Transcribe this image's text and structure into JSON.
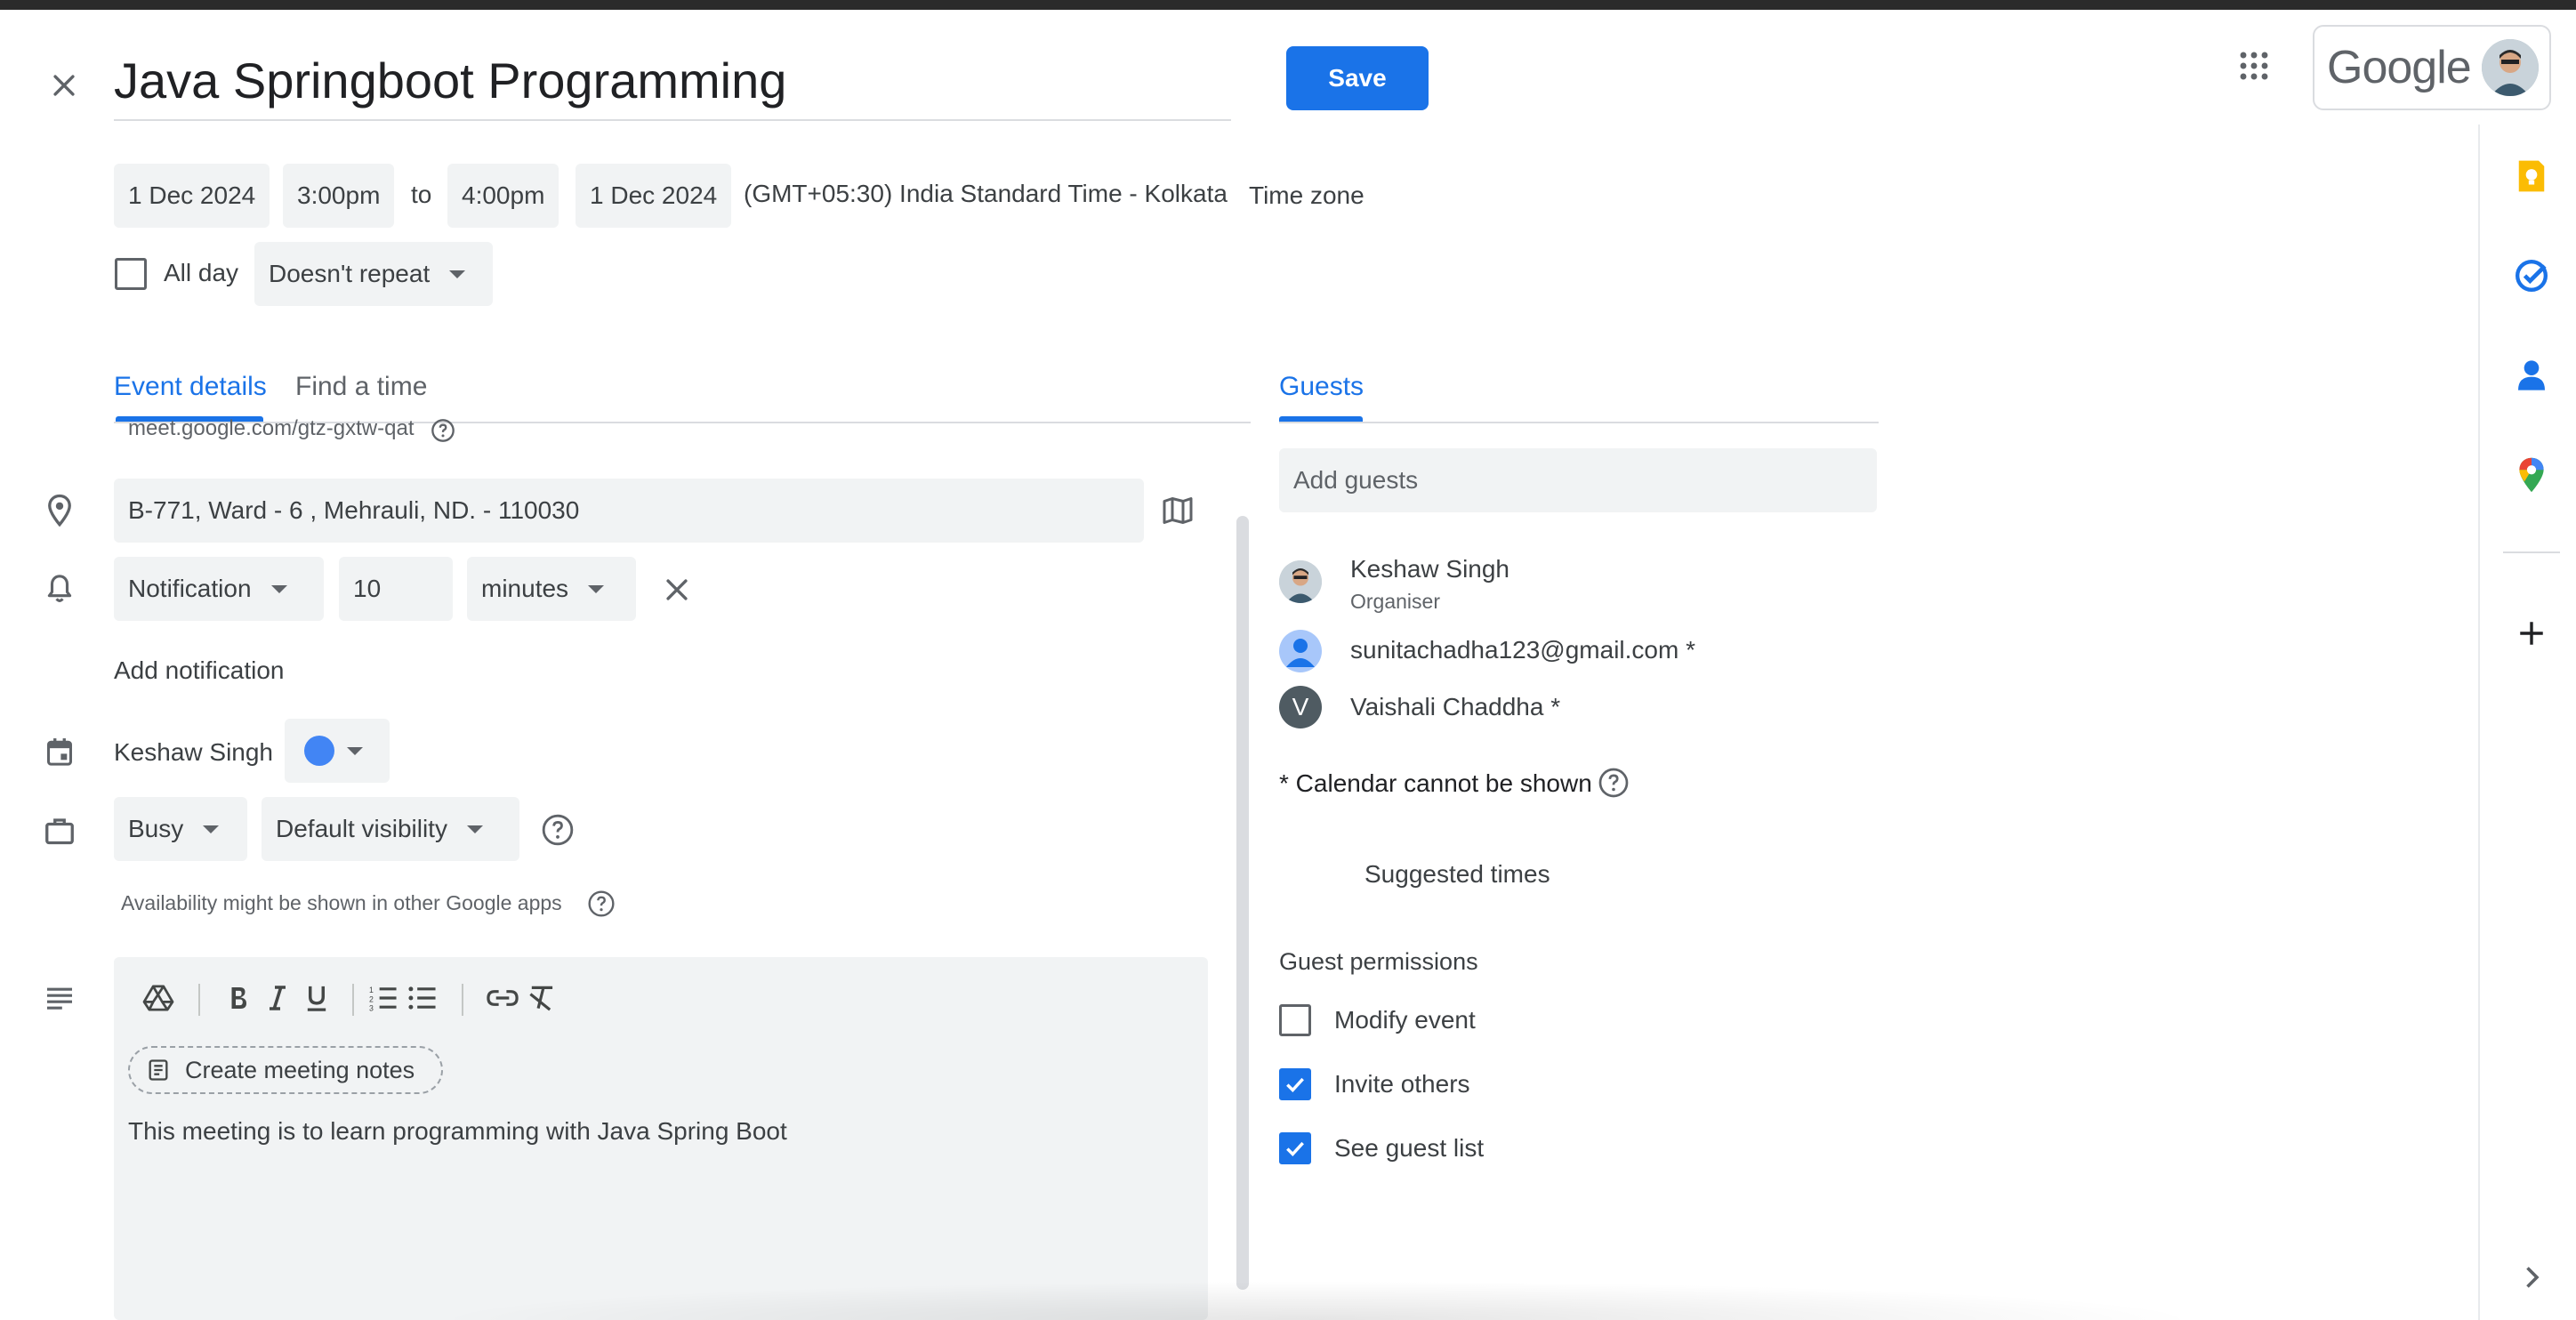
{
  "header": {
    "close_icon": "close-icon",
    "title": "Java Springboot Programming",
    "save_label": "Save",
    "apps_icon": "apps-grid-icon",
    "account_brand": "Google"
  },
  "datetime": {
    "start_date": "1 Dec 2024",
    "start_time": "3:00pm",
    "to_label": "to",
    "end_time": "4:00pm",
    "end_date": "1 Dec 2024",
    "timezone_value": "(GMT+05:30) India Standard Time - Kolkata",
    "timezone_button": "Time zone",
    "all_day_label": "All day",
    "all_day_checked": false,
    "repeat_value": "Doesn't repeat"
  },
  "tabs": {
    "event_details": "Event details",
    "find_a_time": "Find a time",
    "guests": "Guests"
  },
  "details": {
    "meet_link": "meet.google.com/gtz-gxtw-qat",
    "location_value": "B-771, Ward - 6 ,  Mehrauli, ND. - 110030",
    "notification_type": "Notification",
    "notification_amount": "10",
    "notification_unit": "minutes",
    "add_notification": "Add notification",
    "calendar_owner": "Keshaw Singh",
    "calendar_color": "#4285f4",
    "busy_value": "Busy",
    "visibility_value": "Default visibility",
    "availability_note": "Availability might be shown in other Google apps"
  },
  "editor": {
    "create_notes_label": "Create meeting notes",
    "description": "This meeting is to learn programming with Java Spring Boot"
  },
  "guests": {
    "add_placeholder": "Add guests",
    "list": [
      {
        "name": "Keshaw Singh",
        "role": "Organiser",
        "avatar": "photo"
      },
      {
        "name": "sunitachadha123@gmail.com *",
        "role": "",
        "avatar": "person"
      },
      {
        "name": "Vaishali Chaddha *",
        "role": "",
        "avatar_letter": "V"
      }
    ],
    "calendar_note": "* Calendar cannot be shown",
    "suggested_times": "Suggested times",
    "permissions_title": "Guest permissions",
    "permissions": [
      {
        "label": "Modify event",
        "checked": false
      },
      {
        "label": "Invite others",
        "checked": true
      },
      {
        "label": "See guest list",
        "checked": true
      }
    ]
  },
  "colors": {
    "accent": "#1a73e8",
    "keep": "#fbbc04",
    "tasks": "#1a73e8",
    "contacts": "#1a73e8"
  }
}
